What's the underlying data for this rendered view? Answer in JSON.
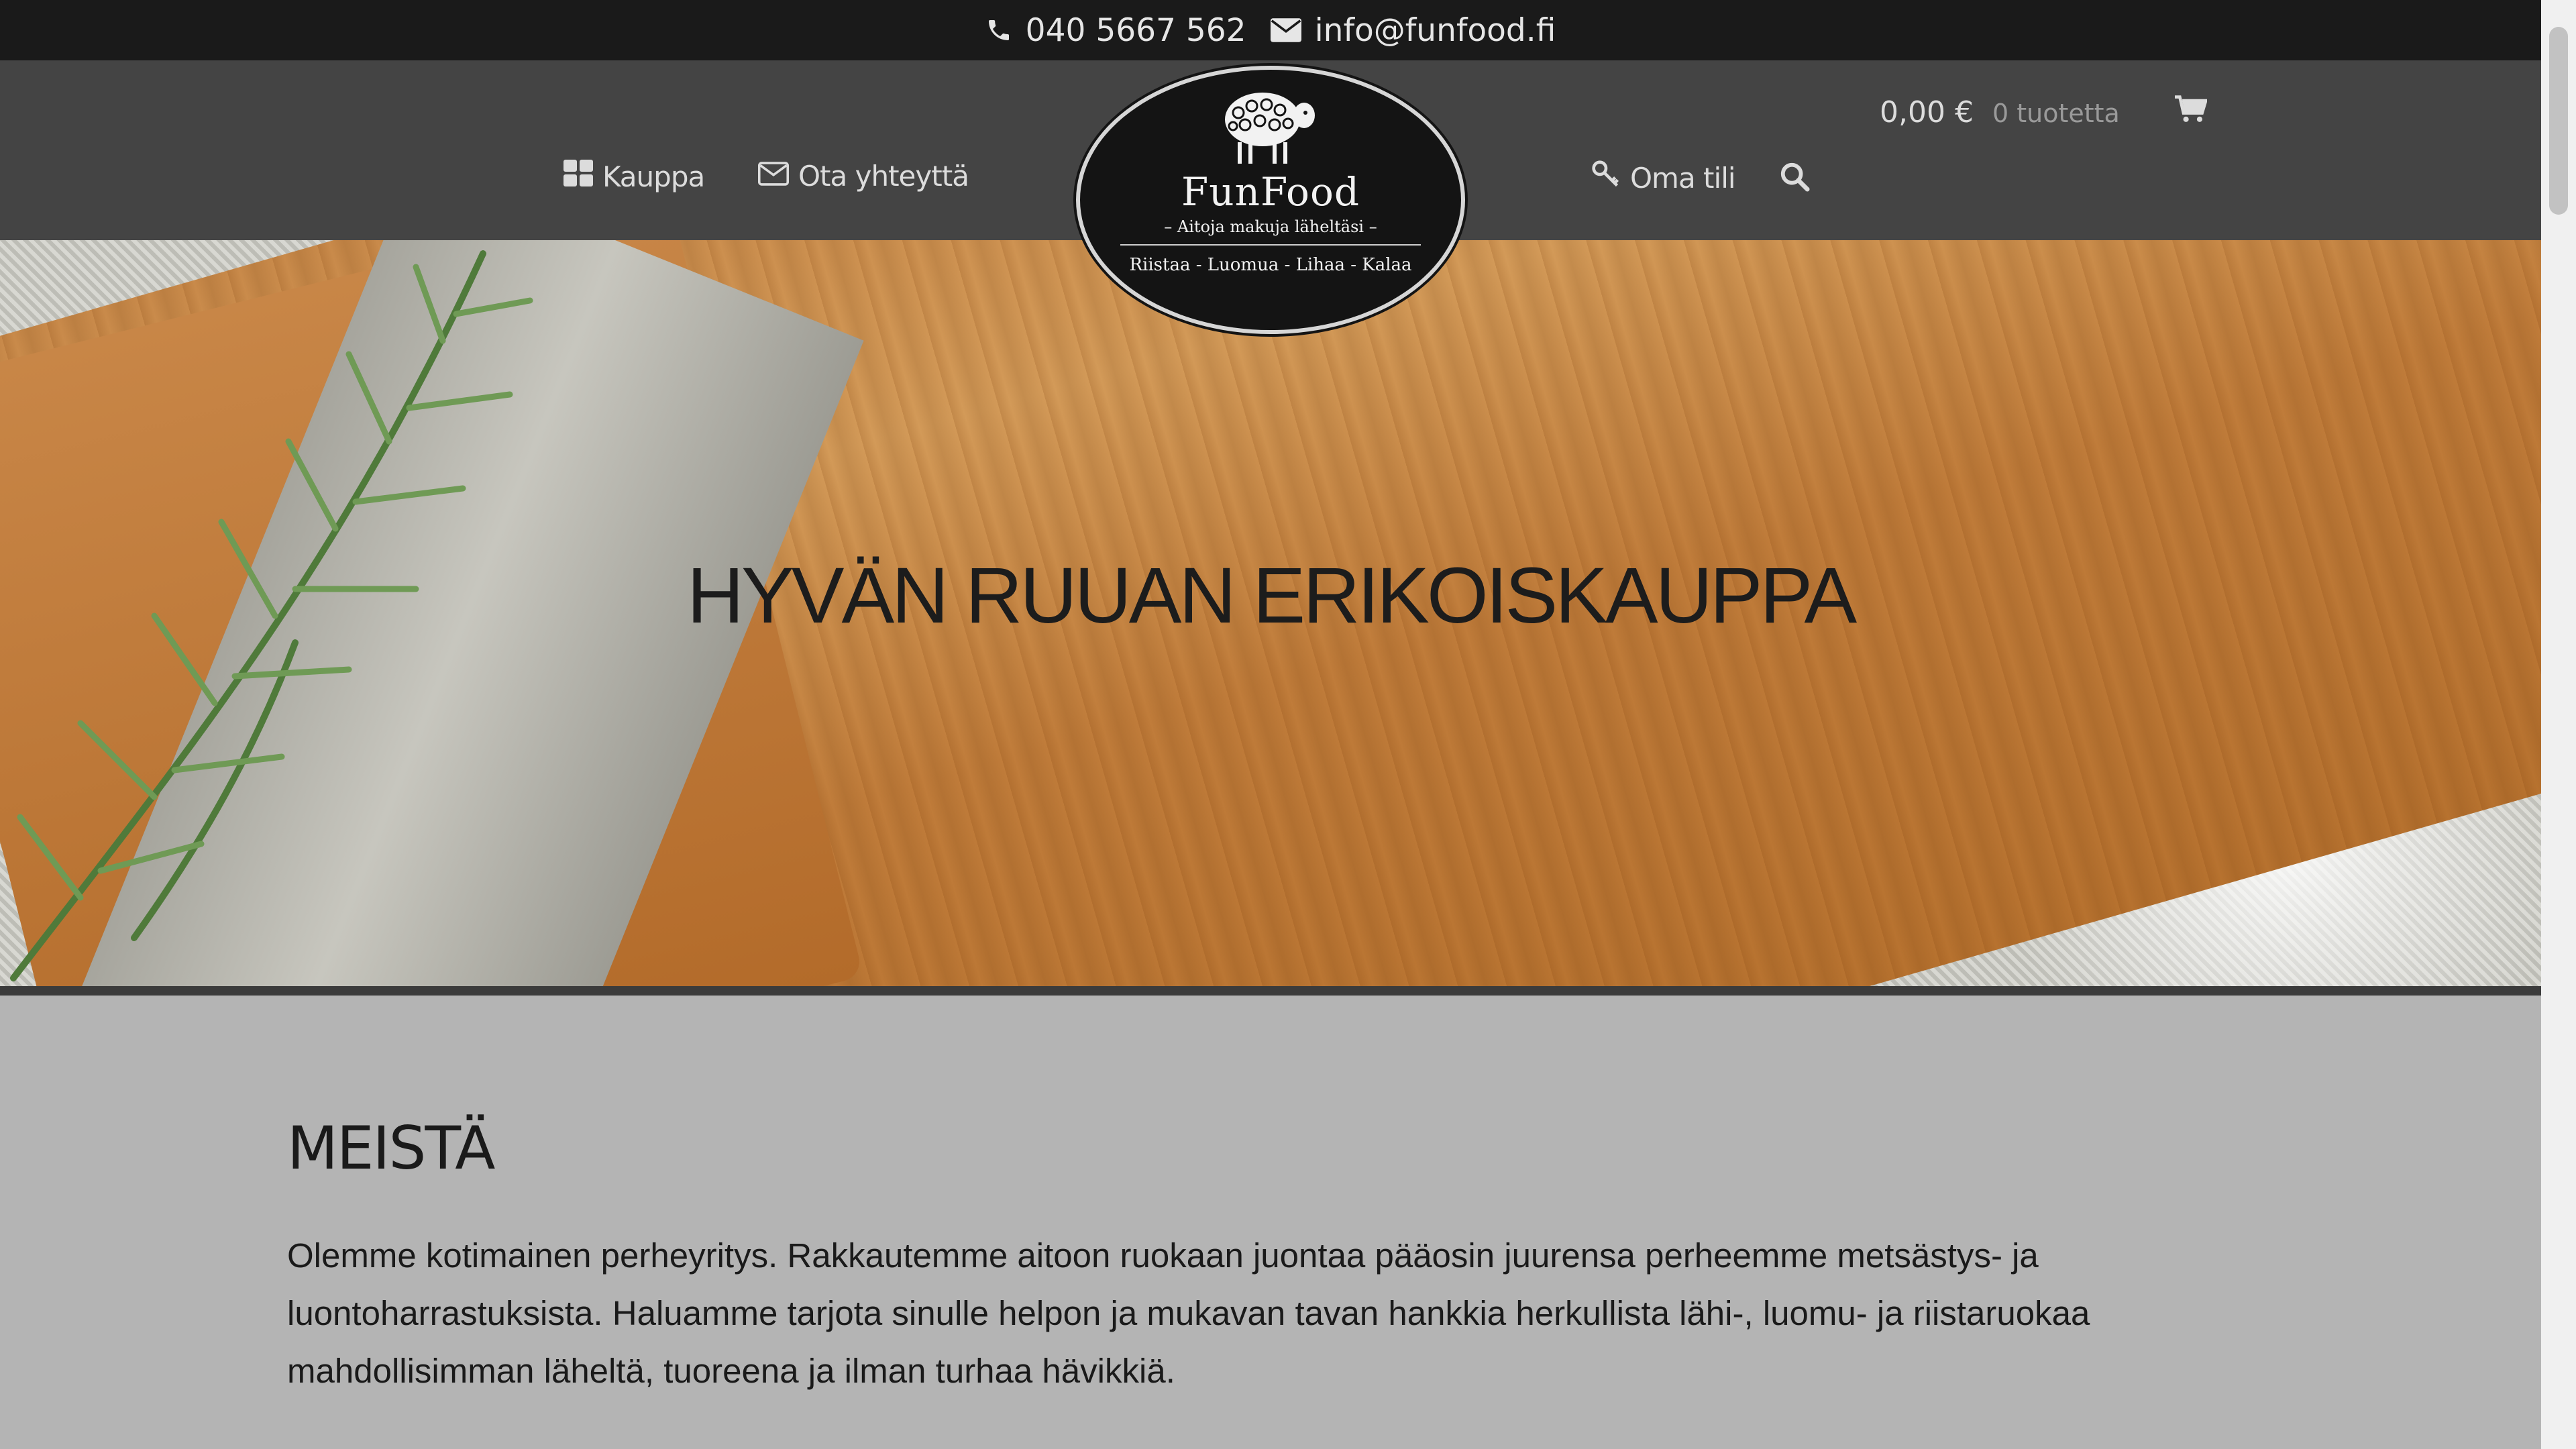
{
  "topbar": {
    "phone": "040 5667 562",
    "email": "info@funfood.fi",
    "phone_icon": "phone-icon",
    "email_icon": "envelope-icon"
  },
  "nav": {
    "shop_label": "Kauppa",
    "contact_label": "Ota yhteyttä",
    "account_label": "Oma tili",
    "shop_icon": "grid-icon",
    "contact_icon": "envelope-outline-icon",
    "account_icon": "key-icon",
    "search_icon": "search-icon"
  },
  "cart": {
    "amount": "0,00 €",
    "count": "0 tuotetta",
    "icon": "shopping-cart-icon"
  },
  "logo": {
    "name": "FunFood",
    "tagline": "– Aitoja makuja läheltäsi –",
    "categories": "Riistaa - Luomua - Lihaa - Kalaa"
  },
  "hero": {
    "title": "HYVÄN RUUAN ERIKOISKAUPPA"
  },
  "about": {
    "heading": "MEISTÄ",
    "text": "Olemme kotimainen perheyritys. Rakkautemme aitoon ruokaan juontaa pääosin juurensa perheemme metsästys- ja luontoharrastuksista. Haluamme tarjota sinulle helpon ja mukavan tavan hankkia herkullista lähi-, luomu- ja riistaruokaa mahdollisimman läheltä, tuoreena ja ilman turhaa hävikkiä."
  },
  "colors": {
    "topbar_bg": "#1a1a1a",
    "navbar_bg": "#444444",
    "content_bg": "#b4b4b4",
    "logo_bg": "#141414"
  }
}
